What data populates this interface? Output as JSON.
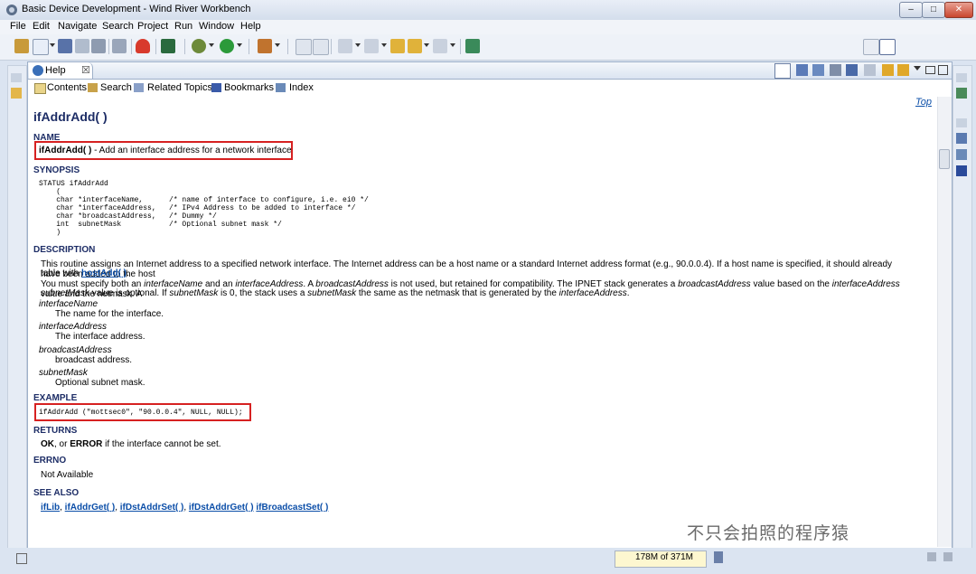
{
  "window": {
    "title": "Basic Device Development - Wind River Workbench",
    "min_label": "–",
    "max_label": "□",
    "close_label": "✕"
  },
  "menu": [
    "File",
    "Edit",
    "Navigate",
    "Search",
    "Project",
    "Run",
    "Window",
    "Help"
  ],
  "help_view": {
    "tab_label": "Help",
    "tab_close": "☒",
    "nav": [
      "Contents",
      "Search",
      "Related Topics",
      "Bookmarks",
      "Index"
    ],
    "top_link": "Top"
  },
  "doc": {
    "title": "ifAddrAdd( )",
    "name_heading": "NAME",
    "name_func": "ifAddrAdd( )",
    "name_desc": " - Add an interface address for a network interface",
    "synopsis_heading": "SYNOPSIS",
    "synopsis_code": "STATUS ifAddrAdd\n    (\n    char *interfaceName,      /* name of interface to configure, i.e. ei0 */\n    char *interfaceAddress,   /* IPv4 Address to be added to interface */\n    char *broadcastAddress,   /* Dummy */\n    int  subnetMask           /* Optional subnet mask */\n    )",
    "description_heading": "DESCRIPTION",
    "desc_p1": "This routine assigns an Internet address to a specified network interface. The Internet address can be a host name or a standard Internet address format (e.g., 90.0.0.4). If a host name is specified, it should already have been added to the host",
    "desc_p1b_prefix": "table with ",
    "desc_p1b_link": "hostAdd( )",
    "desc_p1b_suffix": ".",
    "desc_p2_a": "You must specify both an ",
    "desc_p2_b": "interfaceName",
    "desc_p2_c": " and an ",
    "desc_p2_d": "interfaceAddress",
    "desc_p2_e": ". A ",
    "desc_p2_f": "broadcastAddress",
    "desc_p2_g": " is not used, but retained for compatibility. The IPNET stack generates a ",
    "desc_p2_h": "broadcastAddress",
    "desc_p2_i": " value based on the ",
    "desc_p2_j": "interfaceAddress",
    "desc_p2_k": " value and the netmask. A",
    "desc_p3_a": "subnetMask",
    "desc_p3_b": " value is optional. If ",
    "desc_p3_c": "subnetMask",
    "desc_p3_d": " is 0, the stack uses a ",
    "desc_p3_e": "subnetMask",
    "desc_p3_f": " the same as the netmask that is generated by the ",
    "desc_p3_g": "interfaceAddress",
    "desc_p3_h": ".",
    "params": [
      {
        "term": "interfaceName",
        "def": "The name for the interface."
      },
      {
        "term": "interfaceAddress",
        "def": "The interface address."
      },
      {
        "term": "broadcastAddress",
        "def": "broadcast address."
      },
      {
        "term": "subnetMask",
        "def": "Optional subnet mask."
      }
    ],
    "example_heading": "EXAMPLE",
    "example_code": "ifAddrAdd (\"mottsec0\", \"90.0.0.4\", NULL, NULL);",
    "returns_heading": "RETURNS",
    "returns_ok": "OK",
    "returns_mid": ", or ",
    "returns_error": "ERROR",
    "returns_tail": " if the interface cannot be set.",
    "errno_heading": "ERRNO",
    "errno_text": "Not Available",
    "seealso_heading": "SEE ALSO",
    "seealso_links": [
      "ifLib",
      "ifAddrGet( )",
      "ifDstAddrSet( )",
      "ifDstAddrGet( )",
      "ifBroadcastSet( )"
    ]
  },
  "status": {
    "heap": "178M of 371M"
  },
  "watermark": "不只会拍照的程序猿",
  "colors": {
    "heading": "#1d2d66",
    "link": "#0b4ea8",
    "highlight_box": "#d62121"
  }
}
